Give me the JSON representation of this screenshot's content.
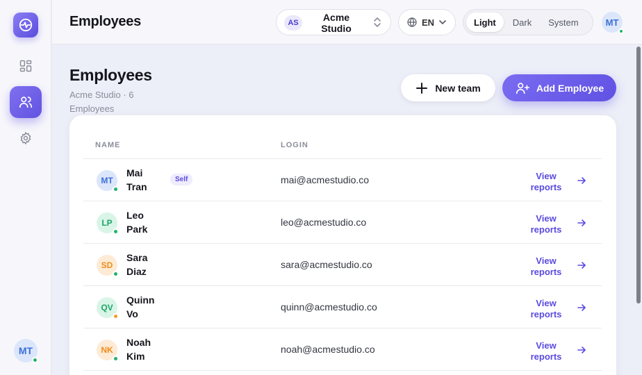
{
  "sidebar": {
    "logo_icon": "activity-pulse-icon",
    "items": [
      {
        "name": "dashboard",
        "icon": "grid-icon",
        "active": false
      },
      {
        "name": "employees",
        "icon": "users-icon",
        "active": true
      },
      {
        "name": "settings",
        "icon": "gear-icon",
        "active": false
      }
    ],
    "user_initials": "MT"
  },
  "topbar": {
    "title": "Employees",
    "org": {
      "initials": "AS",
      "name": "Acme Studio"
    },
    "language": "EN",
    "theme": {
      "options": [
        "Light",
        "Dark",
        "System"
      ],
      "selected": "Light"
    },
    "user_initials": "MT"
  },
  "page": {
    "title": "Employees",
    "subtitle": "Acme Studio · 6 Employees",
    "new_team_label": "New team",
    "add_employee_label": "Add Employee"
  },
  "table": {
    "headers": {
      "name": "NAME",
      "login": "LOGIN"
    },
    "rows": [
      {
        "initials": "MT",
        "name": "Mai Tran",
        "badge": "Self",
        "login": "mai@acmestudio.co",
        "action": "View reports",
        "avatar_bg": "#dbe6fb",
        "avatar_fg": "#3d6fd6",
        "status": "#22b36b"
      },
      {
        "initials": "LP",
        "name": "Leo Park",
        "badge": "",
        "login": "leo@acmestudio.co",
        "action": "View reports",
        "avatar_bg": "#d9f5e8",
        "avatar_fg": "#1fa566",
        "status": "#22b36b"
      },
      {
        "initials": "SD",
        "name": "Sara Diaz",
        "badge": "",
        "login": "sara@acmestudio.co",
        "action": "View reports",
        "avatar_bg": "#fdebd6",
        "avatar_fg": "#f08c1a",
        "status": "#22b36b"
      },
      {
        "initials": "QV",
        "name": "Quinn Vo",
        "badge": "",
        "login": "quinn@acmestudio.co",
        "action": "View reports",
        "avatar_bg": "#d9f5e8",
        "avatar_fg": "#1fa566",
        "status": "#f0a020"
      },
      {
        "initials": "NK",
        "name": "Noah Kim",
        "badge": "",
        "login": "noah@acmestudio.co",
        "action": "View reports",
        "avatar_bg": "#fdebd6",
        "avatar_fg": "#f08c1a",
        "status": "#22b36b"
      }
    ]
  },
  "colors": {
    "accent": "#6556e6",
    "online": "#22b36b",
    "away": "#f0a020"
  }
}
